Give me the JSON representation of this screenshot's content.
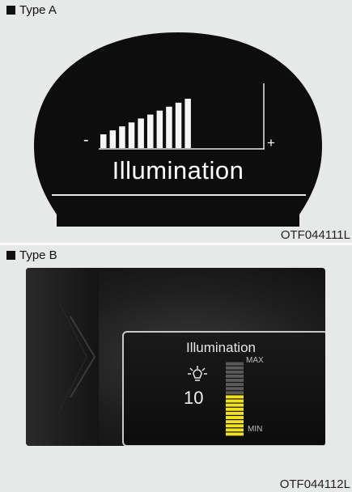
{
  "type_a": {
    "heading": "Type A",
    "display": {
      "title": "Illumination",
      "minus_symbol": "-",
      "plus_symbol": "+",
      "level_filled": 10,
      "level_total": 10
    },
    "code": "OTF044111L"
  },
  "type_b": {
    "heading": "Type B",
    "display": {
      "title": "Illumination",
      "value": "10",
      "max_label": "MAX",
      "min_label": "MIN",
      "level_filled": 10,
      "level_total": 18
    },
    "code": "OTF044112L"
  },
  "colors": {
    "panel_bg": "#e7e9e8",
    "display_bg": "#0d0d0d",
    "bar_white": "#f5f5f5",
    "bar_yellow": "#f2e21c",
    "bar_gray": "#5a5a5a"
  }
}
